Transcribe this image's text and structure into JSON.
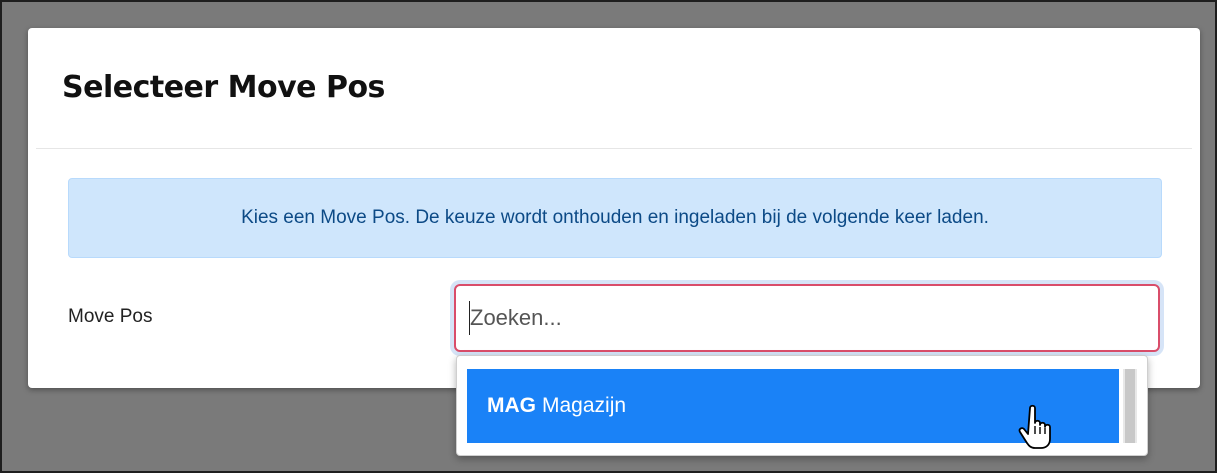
{
  "modal": {
    "title": "Selecteer Move Pos",
    "alert_text": "Kies een Move Pos. De keuze wordt onthouden en ingeladen bij de volgende keer laden."
  },
  "form": {
    "label": "Move Pos",
    "search_placeholder": "Zoeken..."
  },
  "dropdown": {
    "options": [
      {
        "code": "MAG",
        "name": "Magazijn",
        "highlighted": true
      }
    ]
  },
  "colors": {
    "highlight": "#1a82f7",
    "alert_bg": "#cfe6fc",
    "invalid_border": "#d94d6a"
  },
  "icons": {
    "cursor": "hand-pointer-icon"
  }
}
